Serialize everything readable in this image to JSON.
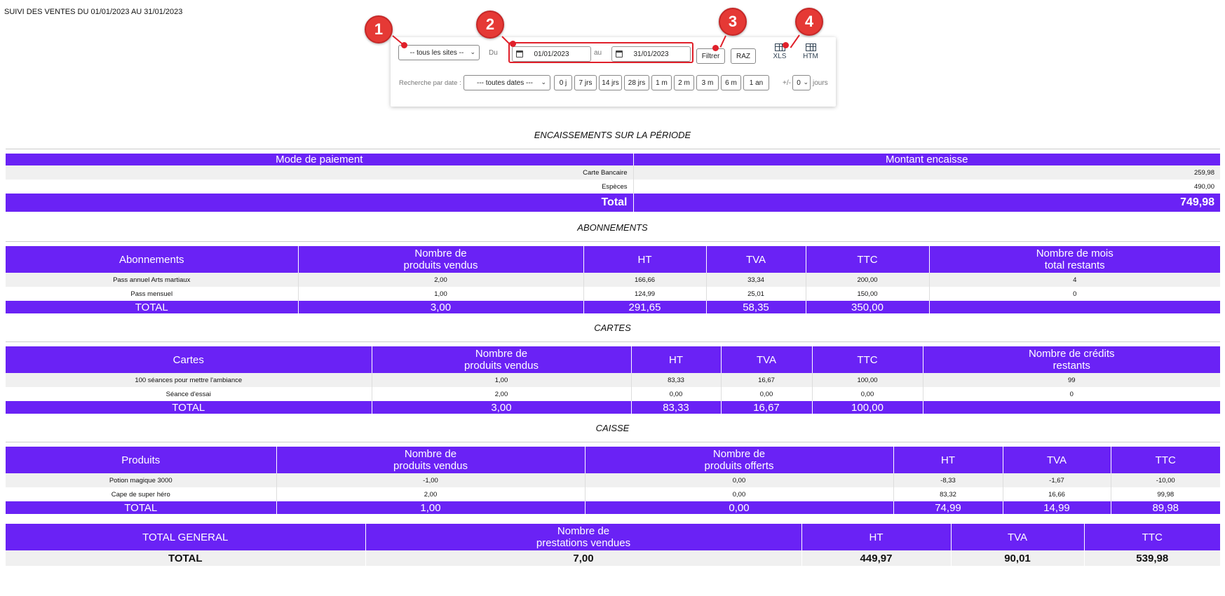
{
  "page_heading": "SUIVI DES VENTES DU 01/01/2023 AU 31/01/2023",
  "filters": {
    "site_select": "-- tous les sites --",
    "du_label": "Du",
    "date_from": "01/01/2023",
    "au_label": "au",
    "date_to": "31/01/2023",
    "filtrer": "Filtrer",
    "raz": "RAZ",
    "xls": "XLS",
    "htm": "HTM",
    "search_label": "Recherche par date :",
    "dates_select": "--- toutes dates ---",
    "quick_ranges": [
      "0 j",
      "7 jrs",
      "14 jrs",
      "28 jrs",
      "1 m",
      "2 m",
      "3 m",
      "6 m",
      "1 an"
    ],
    "plus_minus": "+/-",
    "offset_value": "0",
    "jours": "jours"
  },
  "markers": [
    "1",
    "2",
    "3",
    "4"
  ],
  "marker_color": "#e53935",
  "accent_color": "#6a22f5",
  "encaissements": {
    "title": "ENCAISSEMENTS SUR LA PÉRIODE",
    "headers": [
      "Mode de paiement",
      "Montant encaisse"
    ],
    "rows": [
      [
        "Carte Bancaire",
        "259,98"
      ],
      [
        "Espèces",
        "490,00"
      ]
    ],
    "total": [
      "Total",
      "749,98"
    ]
  },
  "abonnements": {
    "title": "ABONNEMENTS",
    "headers": [
      "Abonnements",
      "Nombre de produits vendus",
      "HT",
      "TVA",
      "TTC",
      "Nombre de mois total restants"
    ],
    "header_lines": [
      [
        "Abonnements"
      ],
      [
        "Nombre de",
        "produits vendus"
      ],
      [
        "HT"
      ],
      [
        "TVA"
      ],
      [
        "TTC"
      ],
      [
        "Nombre de mois",
        "total restants"
      ]
    ],
    "rows": [
      [
        "Pass annuel Arts martiaux",
        "2,00",
        "166,66",
        "33,34",
        "200,00",
        "4"
      ],
      [
        "Pass mensuel",
        "1,00",
        "124,99",
        "25,01",
        "150,00",
        "0"
      ]
    ],
    "total": [
      "TOTAL",
      "3,00",
      "291,65",
      "58,35",
      "350,00",
      ""
    ]
  },
  "cartes": {
    "title": "CARTES",
    "header_lines": [
      [
        "Cartes"
      ],
      [
        "Nombre de",
        "produits vendus"
      ],
      [
        "HT"
      ],
      [
        "TVA"
      ],
      [
        "TTC"
      ],
      [
        "Nombre de crédits",
        "restants"
      ]
    ],
    "rows": [
      [
        "100 séances pour mettre l'ambiance",
        "1,00",
        "83,33",
        "16,67",
        "100,00",
        "99"
      ],
      [
        "Séance d'essai",
        "2,00",
        "0,00",
        "0,00",
        "0,00",
        "0"
      ]
    ],
    "total": [
      "TOTAL",
      "3,00",
      "83,33",
      "16,67",
      "100,00",
      ""
    ]
  },
  "caisse": {
    "title": "CAISSE",
    "header_lines": [
      [
        "Produits"
      ],
      [
        "Nombre de",
        "produits vendus"
      ],
      [
        "Nombre de",
        "produits offerts"
      ],
      [
        "HT"
      ],
      [
        "TVA"
      ],
      [
        "TTC"
      ]
    ],
    "rows": [
      [
        "Potion magique 3000",
        "-1,00",
        "0,00",
        "-8,33",
        "-1,67",
        "-10,00"
      ],
      [
        "Cape de super héro",
        "2,00",
        "0,00",
        "83,32",
        "16,66",
        "99,98"
      ]
    ],
    "total": [
      "TOTAL",
      "1,00",
      "0,00",
      "74,99",
      "14,99",
      "89,98"
    ]
  },
  "total_general": {
    "header_lines": [
      [
        "TOTAL GENERAL"
      ],
      [
        "Nombre de",
        "prestations vendues"
      ],
      [
        "HT"
      ],
      [
        "TVA"
      ],
      [
        "TTC"
      ]
    ],
    "row": [
      "TOTAL",
      "7,00",
      "449,97",
      "90,01",
      "539,98"
    ]
  }
}
